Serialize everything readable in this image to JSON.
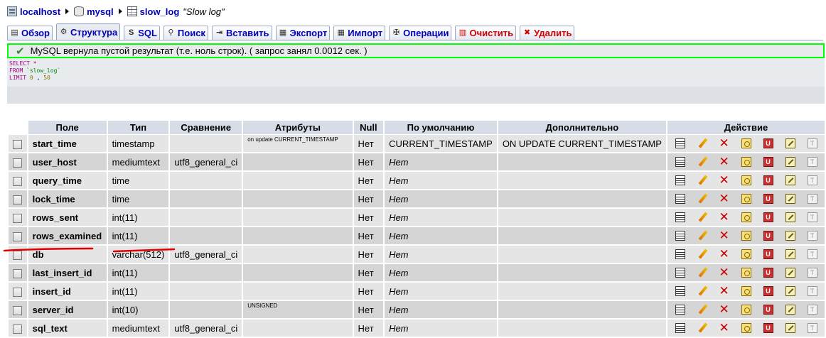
{
  "breadcrumb": {
    "server": "localhost",
    "database": "mysql",
    "table": "slow_log",
    "comment": "\"Slow log\""
  },
  "tabs": [
    {
      "label": "Обзор",
      "icon": "browse-icon"
    },
    {
      "label": "Структура",
      "icon": "structure-icon",
      "active": true
    },
    {
      "label": "SQL",
      "icon": "sql-icon"
    },
    {
      "label": "Поиск",
      "icon": "search-icon"
    },
    {
      "label": "Вставить",
      "icon": "insert-icon"
    },
    {
      "label": "Экспорт",
      "icon": "export-icon"
    },
    {
      "label": "Импорт",
      "icon": "import-icon"
    },
    {
      "label": "Операции",
      "icon": "operations-icon"
    },
    {
      "label": "Очистить",
      "icon": "empty-icon",
      "danger": true
    },
    {
      "label": "Удалить",
      "icon": "drop-icon",
      "danger": true
    }
  ],
  "message": {
    "text": "MySQL вернула пустой результат (т.е. ноль строк). ( запрос занял 0.0012 сек. )",
    "status_color": "#00ff00"
  },
  "sql": {
    "select_kw": "SELECT",
    "select_cols": "*",
    "from_kw": "FROM",
    "table_str": "`slow_log`",
    "limit_kw": "LIMIT",
    "limit_offset": "0",
    "limit_count": "50"
  },
  "columns": {
    "field": "Поле",
    "type": "Тип",
    "collation": "Сравнение",
    "attributes": "Атрибуты",
    "null": "Null",
    "default": "По умолчанию",
    "extra": "Дополнительно",
    "action": "Действие"
  },
  "rows": [
    {
      "field": "start_time",
      "type": "timestamp",
      "collation": "",
      "attributes": "on update CURRENT_TIMESTAMP",
      "null": "Нет",
      "default": "CURRENT_TIMESTAMP",
      "extra": "ON UPDATE CURRENT_TIMESTAMP"
    },
    {
      "field": "user_host",
      "type": "mediumtext",
      "collation": "utf8_general_ci",
      "attributes": "",
      "null": "Нет",
      "default": "Нет",
      "extra": ""
    },
    {
      "field": "query_time",
      "type": "time",
      "collation": "",
      "attributes": "",
      "null": "Нет",
      "default": "Нет",
      "extra": ""
    },
    {
      "field": "lock_time",
      "type": "time",
      "collation": "",
      "attributes": "",
      "null": "Нет",
      "default": "Нет",
      "extra": ""
    },
    {
      "field": "rows_sent",
      "type": "int(11)",
      "collation": "",
      "attributes": "",
      "null": "Нет",
      "default": "Нет",
      "extra": ""
    },
    {
      "field": "rows_examined",
      "type": "int(11)",
      "collation": "",
      "attributes": "",
      "null": "Нет",
      "default": "Нет",
      "extra": ""
    },
    {
      "field": "db",
      "type": "varchar(512)",
      "collation": "utf8_general_ci",
      "attributes": "",
      "null": "Нет",
      "default": "Нет",
      "extra": ""
    },
    {
      "field": "last_insert_id",
      "type": "int(11)",
      "collation": "",
      "attributes": "",
      "null": "Нет",
      "default": "Нет",
      "extra": ""
    },
    {
      "field": "insert_id",
      "type": "int(11)",
      "collation": "",
      "attributes": "",
      "null": "Нет",
      "default": "Нет",
      "extra": ""
    },
    {
      "field": "server_id",
      "type": "int(10)",
      "collation": "",
      "attributes": "UNSIGNED",
      "null": "Нет",
      "default": "Нет",
      "extra": ""
    },
    {
      "field": "sql_text",
      "type": "mediumtext",
      "collation": "utf8_general_ci",
      "attributes": "",
      "null": "Нет",
      "default": "Нет",
      "extra": ""
    }
  ],
  "action_icons": [
    "browse-distinct-icon",
    "edit-pencil-icon",
    "delete-x-icon",
    "primary-key-icon",
    "unique-icon",
    "index-icon",
    "fulltext-icon"
  ],
  "annotation": {
    "color": "#e00000",
    "marked_field": "db"
  }
}
